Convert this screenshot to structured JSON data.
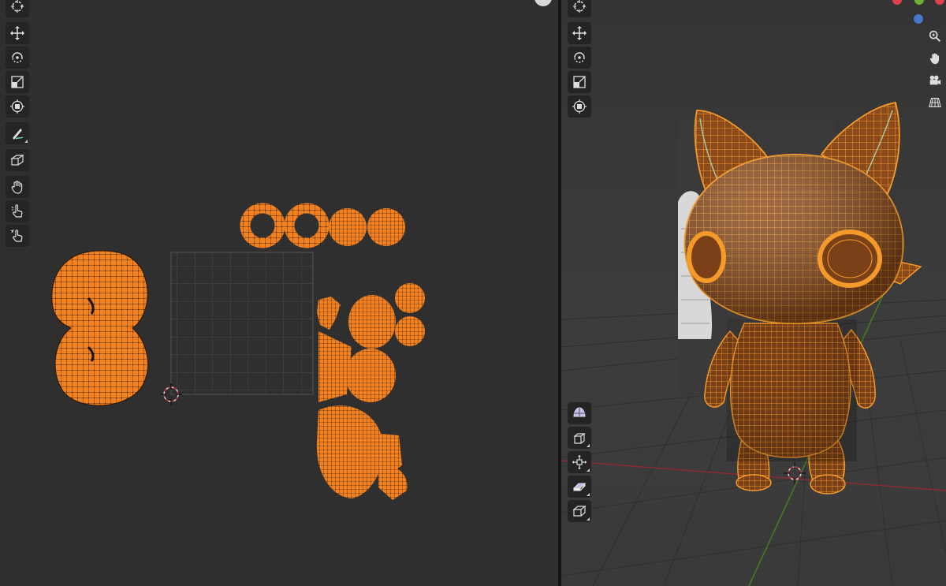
{
  "uv_editor": {
    "toolbar": [
      [
        "cursor-tool"
      ],
      [
        "move-tool",
        "rotate-tool",
        "scale-tool",
        "transform-tool"
      ],
      [
        "annotate-tool"
      ],
      [
        "rip-region-tool"
      ],
      [
        "grab-tool",
        "relax-tool",
        "pinch-tool"
      ]
    ],
    "grid_divisions": 8,
    "wire_color": "#1e1e1e",
    "uv_fill_color": "#f08020"
  },
  "viewport": {
    "toolbar_top": [
      "cursor-tool",
      "move-tool",
      "rotate-tool",
      "scale-tool",
      "transform-tool"
    ],
    "toolbar_bottom": [
      "loop-cut-tool",
      "extrude-tool",
      "spin-tool",
      "shear-tool",
      "inset-tool"
    ],
    "navigation": [
      "zoom-icon",
      "hand-pan-icon",
      "camera-icon",
      "grid-perspective-icon"
    ],
    "axis_colors": {
      "x": "#e04050",
      "y": "#70b030",
      "z": "#4a78c8"
    },
    "mesh_wire_color": "#f39a2a",
    "mesh_face_color": "#8a4a1c"
  }
}
